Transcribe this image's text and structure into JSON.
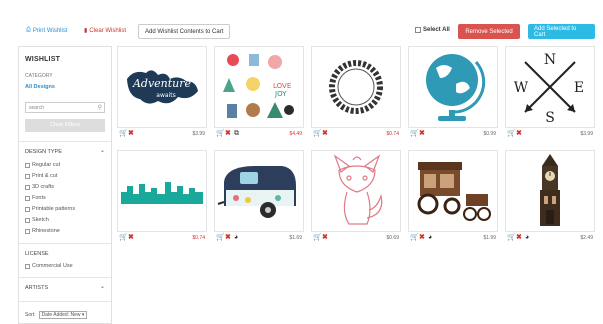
{
  "toolbar": {
    "print_wishlist": "Print Wishlist",
    "clear_wishlist": "Clear Wishlist",
    "add_contents": "Add Wishlist Contents to Cart",
    "select_all": "Select All",
    "remove_selected": "Remove Selected",
    "add_selected": "Add Selected to Cart"
  },
  "sidebar": {
    "title": "WISHLIST",
    "category_label": "CATEGORY",
    "category_value": "All Designs",
    "search_placeholder": "search",
    "clear_filters": "Clear Filters",
    "design_type_label": "DESIGN TYPE",
    "design_types": [
      "Regular cut",
      "Print & cut",
      "3D crafts",
      "Fonts",
      "Printable patterns",
      "Sketch",
      "Rhinestone"
    ],
    "license_label": "LICENSE",
    "licenses": [
      "Commercial Use"
    ],
    "artists_label": "ARTISTS",
    "sort_label": "Sort:",
    "sort_value": "Date Added: New"
  },
  "items": [
    {
      "title": "Adventure Awaits map",
      "price": "$3.99",
      "price_style": "grey",
      "extra_icon": ""
    },
    {
      "title": "Winter pattern",
      "price": "$4.49",
      "price_style": "red",
      "extra_icon": "layers"
    },
    {
      "title": "Laurel wreath",
      "price": "$0.74",
      "price_style": "red",
      "extra_icon": ""
    },
    {
      "title": "Globe",
      "price": "$0.99",
      "price_style": "grey",
      "extra_icon": ""
    },
    {
      "title": "Compass arrows",
      "price": "$3.99",
      "price_style": "grey",
      "extra_icon": ""
    },
    {
      "title": "City skyline border",
      "price": "$0.74",
      "price_style": "red",
      "extra_icon": ""
    },
    {
      "title": "Camper trailer",
      "price": "$1.69",
      "price_style": "grey",
      "extra_icon": "3d"
    },
    {
      "title": "Fox",
      "price": "$0.69",
      "price_style": "grey",
      "extra_icon": ""
    },
    {
      "title": "Wagon",
      "price": "$1.99",
      "price_style": "grey",
      "extra_icon": "3d"
    },
    {
      "title": "Clock tower",
      "price": "$2.49",
      "price_style": "grey",
      "extra_icon": "3d"
    }
  ],
  "icons": {
    "cart": "shopping-cart-icon",
    "remove": "remove-x-icon",
    "layers": "layers-icon",
    "3d": "3d-sphere-icon"
  },
  "colors": {
    "blue_link": "#2a8fd0",
    "red": "#d9302c",
    "remove_btn": "#d9534f",
    "add_btn": "#2dbbe5"
  }
}
